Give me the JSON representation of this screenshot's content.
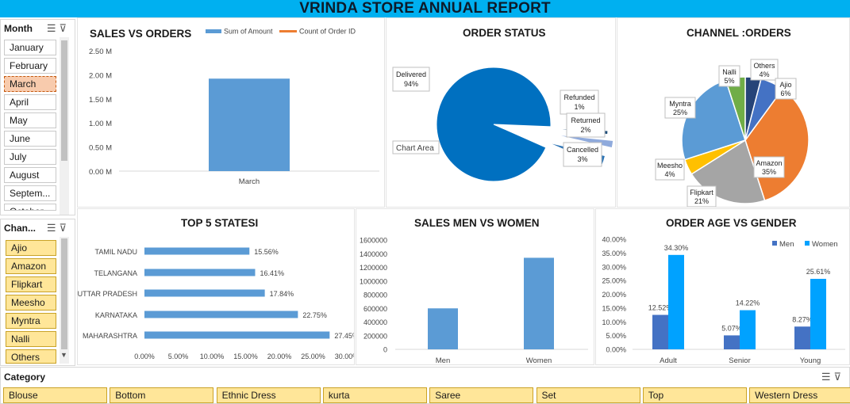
{
  "report_title": "VRINDA STORE ANNUAL REPORT",
  "icons": {
    "multi_select": "multi-select-icon",
    "clear_filter": "clear-filter-icon",
    "scroll_down": "chevron-down-icon"
  },
  "colors": {
    "banner": "#00b0f0",
    "bar_blue": "#5b9bd5",
    "women": "#00a2ff",
    "men": "#4472c4",
    "selected_item": "#f8cbad",
    "slicer_item": "#ffe699"
  },
  "month_slicer": {
    "title": "Month",
    "items": [
      "January",
      "February",
      "March",
      "April",
      "May",
      "June",
      "July",
      "August",
      "Septem...",
      "October"
    ],
    "selected": "March"
  },
  "channel_slicer": {
    "title": "Chan...",
    "items": [
      "Ajio",
      "Amazon",
      "Flipkart",
      "Meesho",
      "Myntra",
      "Nalli",
      "Others"
    ]
  },
  "category_slicer": {
    "title": "Category",
    "items": [
      "Blouse",
      "Bottom",
      "Ethnic Dress",
      "kurta",
      "Saree",
      "Set",
      "Top",
      "Western Dress"
    ]
  },
  "chart_data": [
    {
      "type": "bar",
      "title": "SALES VS ORDERS",
      "categories": [
        "March"
      ],
      "series": [
        {
          "name": "Sum of Amount",
          "values": [
            1920000
          ]
        },
        {
          "name": "Count of Order ID",
          "values": [
            0
          ]
        }
      ],
      "ylim": [
        0,
        2500000
      ],
      "yticks": [
        "0.00 M",
        "0.50 M",
        "1.00 M",
        "1.50 M",
        "2.00 M",
        "2.50 M"
      ],
      "legend": "top"
    },
    {
      "type": "pie",
      "title": "ORDER STATUS",
      "labels": [
        "Delivered",
        "Refunded",
        "Returned",
        "Cancelled"
      ],
      "values": [
        94,
        1,
        2,
        3
      ],
      "display": [
        "94%",
        "1%",
        "2%",
        "3%"
      ],
      "annotation": "Chart Area"
    },
    {
      "type": "pie",
      "title": "CHANNEL :ORDERS",
      "labels": [
        "Amazon",
        "Flipkart",
        "Meesho",
        "Myntra",
        "Nalli",
        "Others",
        "Ajio"
      ],
      "values": [
        35,
        21,
        4,
        25,
        5,
        4,
        6
      ],
      "display": [
        "35%",
        "21%",
        "4%",
        "25%",
        "5%",
        "4%",
        "6%"
      ]
    },
    {
      "type": "bar",
      "orientation": "horizontal",
      "title": "TOP 5 STATESI",
      "categories": [
        "TAMIL NADU",
        "TELANGANA",
        "UTTAR PRADESH",
        "KARNATAKA",
        "MAHARASHTRA"
      ],
      "values": [
        15.56,
        16.41,
        17.84,
        22.75,
        27.45
      ],
      "data_labels": [
        "15.56%",
        "16.41%",
        "17.84%",
        "22.75%",
        "27.45%"
      ],
      "xlim": [
        0,
        30
      ],
      "xticks": [
        "0.00%",
        "5.00%",
        "10.00%",
        "15.00%",
        "20.00%",
        "25.00%",
        "30.00%"
      ]
    },
    {
      "type": "bar",
      "title": "SALES MEN VS WOMEN",
      "categories": [
        "Men",
        "Women"
      ],
      "values": [
        600000,
        1340000
      ],
      "ylim": [
        0,
        1600000
      ],
      "yticks": [
        "0",
        "200000",
        "400000",
        "600000",
        "800000",
        "1000000",
        "1200000",
        "1400000",
        "1600000"
      ]
    },
    {
      "type": "bar",
      "title": "ORDER AGE VS GENDER",
      "categories": [
        "Adult",
        "Senior",
        "Young"
      ],
      "series": [
        {
          "name": "Men",
          "values": [
            12.52,
            5.07,
            8.27
          ],
          "labels": [
            "12.52%",
            "5.07%",
            "8.27%"
          ]
        },
        {
          "name": "Women",
          "values": [
            34.3,
            14.22,
            25.61
          ],
          "labels": [
            "34.30%",
            "14.22%",
            "25.61%"
          ]
        }
      ],
      "ylim": [
        0,
        40
      ],
      "yticks": [
        "0.00%",
        "5.00%",
        "10.00%",
        "15.00%",
        "20.00%",
        "25.00%",
        "30.00%",
        "35.00%",
        "40.00%"
      ],
      "legend": "top-right"
    }
  ]
}
